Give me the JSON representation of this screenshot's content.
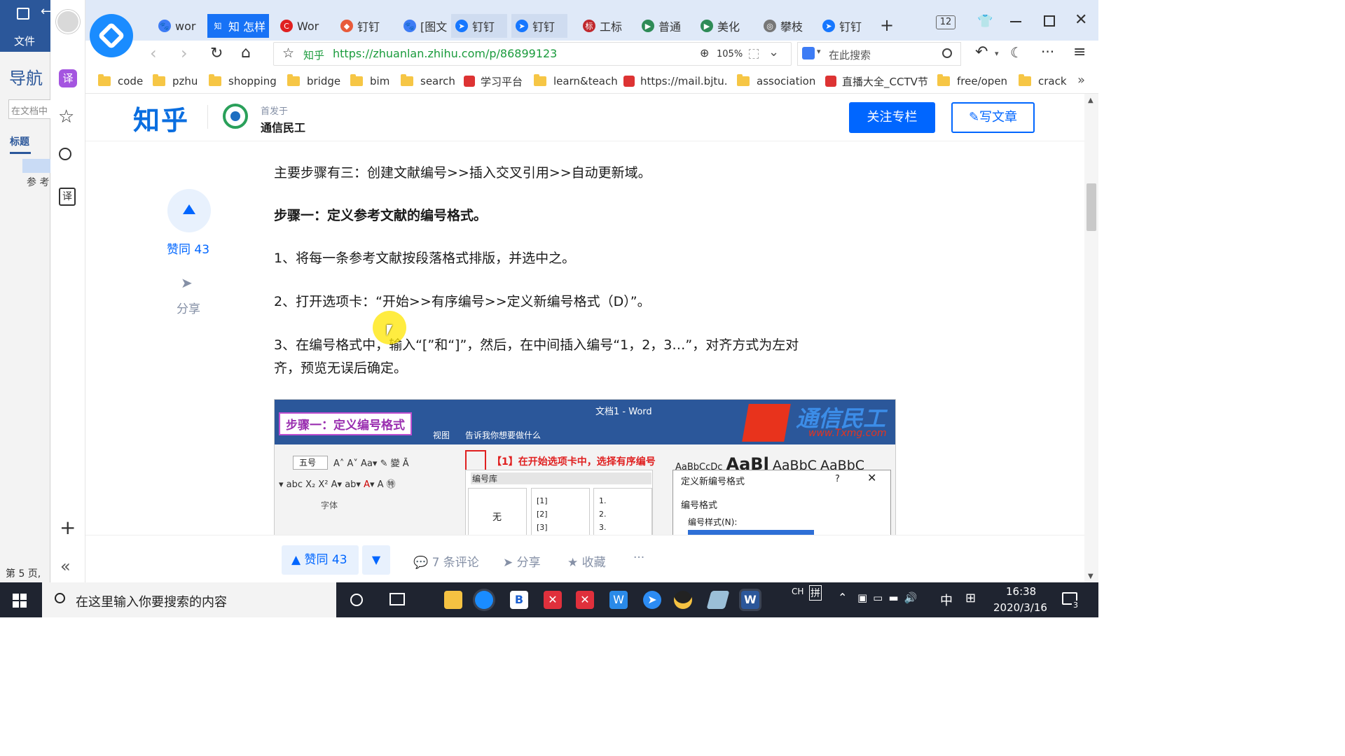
{
  "word": {
    "save_icon": "save-icon",
    "file_label": "文件",
    "nav_title": "导航",
    "search_placeholder": "在文档中",
    "tab_headings": "标题",
    "item_ref": "参 考",
    "page_status": "第 5 页,"
  },
  "browser": {
    "sidebar": {
      "icons": [
        "avatar",
        "translate-icon",
        "star-icon",
        "search-icon",
        "translate-doc-icon",
        "plus-icon",
        "collapse-icon"
      ]
    },
    "tabs": [
      {
        "label": "wor",
        "color": "#3d7cf5",
        "glyph": "🐾"
      },
      {
        "label": "知 怎样",
        "color": "#1772f6",
        "glyph": "知"
      },
      {
        "label": "Wor",
        "color": "#e02020",
        "glyph": "C"
      },
      {
        "label": "钉钉",
        "color": "#e85b3b",
        "glyph": "◆"
      },
      {
        "label": "[图文",
        "color": "#3d7cf5",
        "glyph": "🐾"
      },
      {
        "label": "钉钉",
        "color": "#1677ff",
        "glyph": "➤"
      },
      {
        "label": "钉钉",
        "color": "#1677ff",
        "glyph": "➤"
      },
      {
        "label": "工标",
        "color": "#c0282d",
        "glyph": "标"
      },
      {
        "label": "普通",
        "color": "#2e8b57",
        "glyph": "▶"
      },
      {
        "label": "美化",
        "color": "#2e8b57",
        "glyph": "▶"
      },
      {
        "label": "攀枝",
        "color": "#777777",
        "glyph": "◎"
      },
      {
        "label": "钉钉",
        "color": "#1677ff",
        "glyph": "➤"
      }
    ],
    "tab_count": "12",
    "url_site": "知乎",
    "url": "https://zhuanlan.zhihu.com/p/86899123",
    "zoom": "105%",
    "search_placeholder": "在此搜索",
    "bookmarks": [
      {
        "label": "code",
        "type": "folder"
      },
      {
        "label": "pzhu",
        "type": "folder"
      },
      {
        "label": "shopping",
        "type": "folder"
      },
      {
        "label": "bridge",
        "type": "folder"
      },
      {
        "label": "bim",
        "type": "folder"
      },
      {
        "label": "search",
        "type": "folder"
      },
      {
        "label": "学习平台",
        "type": "site"
      },
      {
        "label": "learn&teach",
        "type": "folder"
      },
      {
        "label": "https://mail.bjtu.",
        "type": "site"
      },
      {
        "label": "association",
        "type": "folder"
      },
      {
        "label": "直播大全_CCTV节",
        "type": "site"
      },
      {
        "label": "free/open",
        "type": "folder"
      },
      {
        "label": "crack",
        "type": "folder"
      }
    ]
  },
  "zhihu": {
    "logo": "知乎",
    "first_published": "首发于",
    "column_name": "通信民工",
    "follow_button": "关注专栏",
    "write_button": "写文章",
    "upvote_label": "赞同 43",
    "share_label": "分享",
    "paragraphs": [
      "主要步骤有三：创建文献编号>>插入交叉引用>>自动更新域。",
      "步骤一：定义参考文献的编号格式。",
      "1、将每一条参考文献按段落格式排版，并选中之。",
      "2、打开选项卡：“开始>>有序编号>>定义新编号格式（D）”。",
      "3、在编号格式中，输入“[”和“]”，然后，在中间插入编号“1，2，3…”，对齐方式为左对",
      "齐，预览无误后确定。"
    ],
    "embed": {
      "title": "文档1 - Word",
      "step_label": "步骤一：定义编号格式",
      "watermark": "通信民工",
      "watermark_url": "www.Txmg.com",
      "ribbon_view": "视图",
      "tell_me": "告诉我你想要做什么",
      "font_size": "五号",
      "font_group": "字体",
      "instruction": "【1】在开始选项卡中，选择有序编号",
      "numbering_lib": "编号库",
      "none_label": "无",
      "list_a": [
        "[1]",
        "[2]",
        "[3]"
      ],
      "list_b": [
        "1.",
        "2.",
        "3."
      ],
      "styles": [
        "AaBbCcDc",
        "AaBl",
        "AaBbC",
        "AaBbC"
      ],
      "dialog_title": "定义新编号格式",
      "dialog_help": "?",
      "format_label": "编号格式",
      "style_label": "编号样式(N):"
    },
    "actions": {
      "upvote": "赞同 43",
      "comments": "7 条评论",
      "share": "分享",
      "favorite": "收藏",
      "more": "···"
    }
  },
  "taskbar": {
    "search_placeholder": "在这里输入你要搜索的内容",
    "ime": "CH",
    "ime2": "拼",
    "lang": "中",
    "time": "16:38",
    "date": "2020/3/16",
    "notif_count": "3"
  }
}
